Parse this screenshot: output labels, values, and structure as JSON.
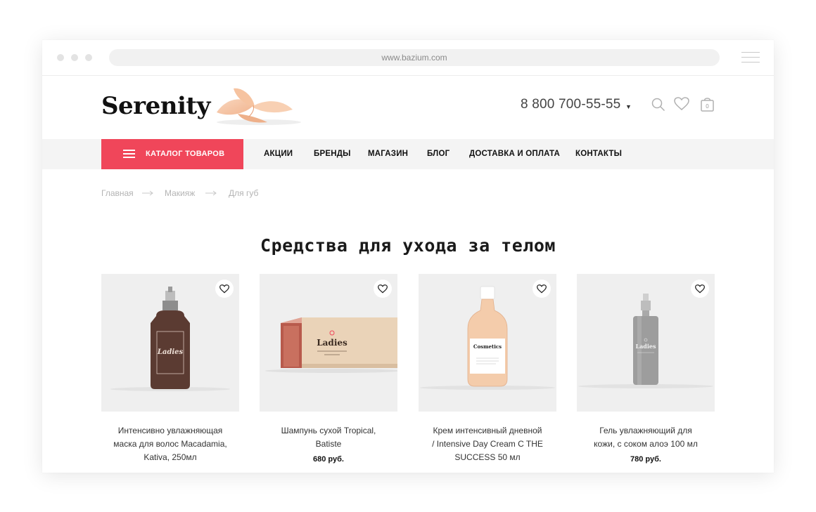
{
  "browser": {
    "url": "www.bazium.com"
  },
  "header": {
    "logo": "Serenity",
    "phone": "8 800 700-55-55",
    "cart_count": "0"
  },
  "nav": {
    "catalog_label": "КАТАЛОГ ТОВАРОВ",
    "items": [
      "АКЦИИ",
      "БРЕНДЫ",
      "МАГАЗИН",
      "БЛОГ",
      "ДОСТАВКА И ОПЛАТА",
      "КОНТАКТЫ"
    ]
  },
  "breadcrumbs": [
    "Главная",
    "Макияж",
    "Для губ"
  ],
  "page": {
    "title": "Средства для ухода за телом"
  },
  "products": [
    {
      "name_lines": [
        "Интенсивно увлажняющая",
        "маска для волос Macadamia,",
        "Kativa, 250мл"
      ],
      "price": "",
      "label": "Ladies"
    },
    {
      "name_lines": [
        "Шампунь сухой Tropical,",
        "Batiste"
      ],
      "price": "680 руб.",
      "label": "Ladies"
    },
    {
      "name_lines": [
        "Крем интенсивный дневной",
        "/ Intensive Day Cream C THE",
        "SUCCESS 50 мл"
      ],
      "price": "",
      "label": "Cosmetics"
    },
    {
      "name_lines": [
        "Гель увлажняющий для",
        "кожи, с соком алоэ 100 мл"
      ],
      "price": "780 руб.",
      "label": "Ladies"
    }
  ],
  "colors": {
    "accent": "#f0465a",
    "nav_bg": "#f4f4f4",
    "card_bg": "#efefef"
  }
}
